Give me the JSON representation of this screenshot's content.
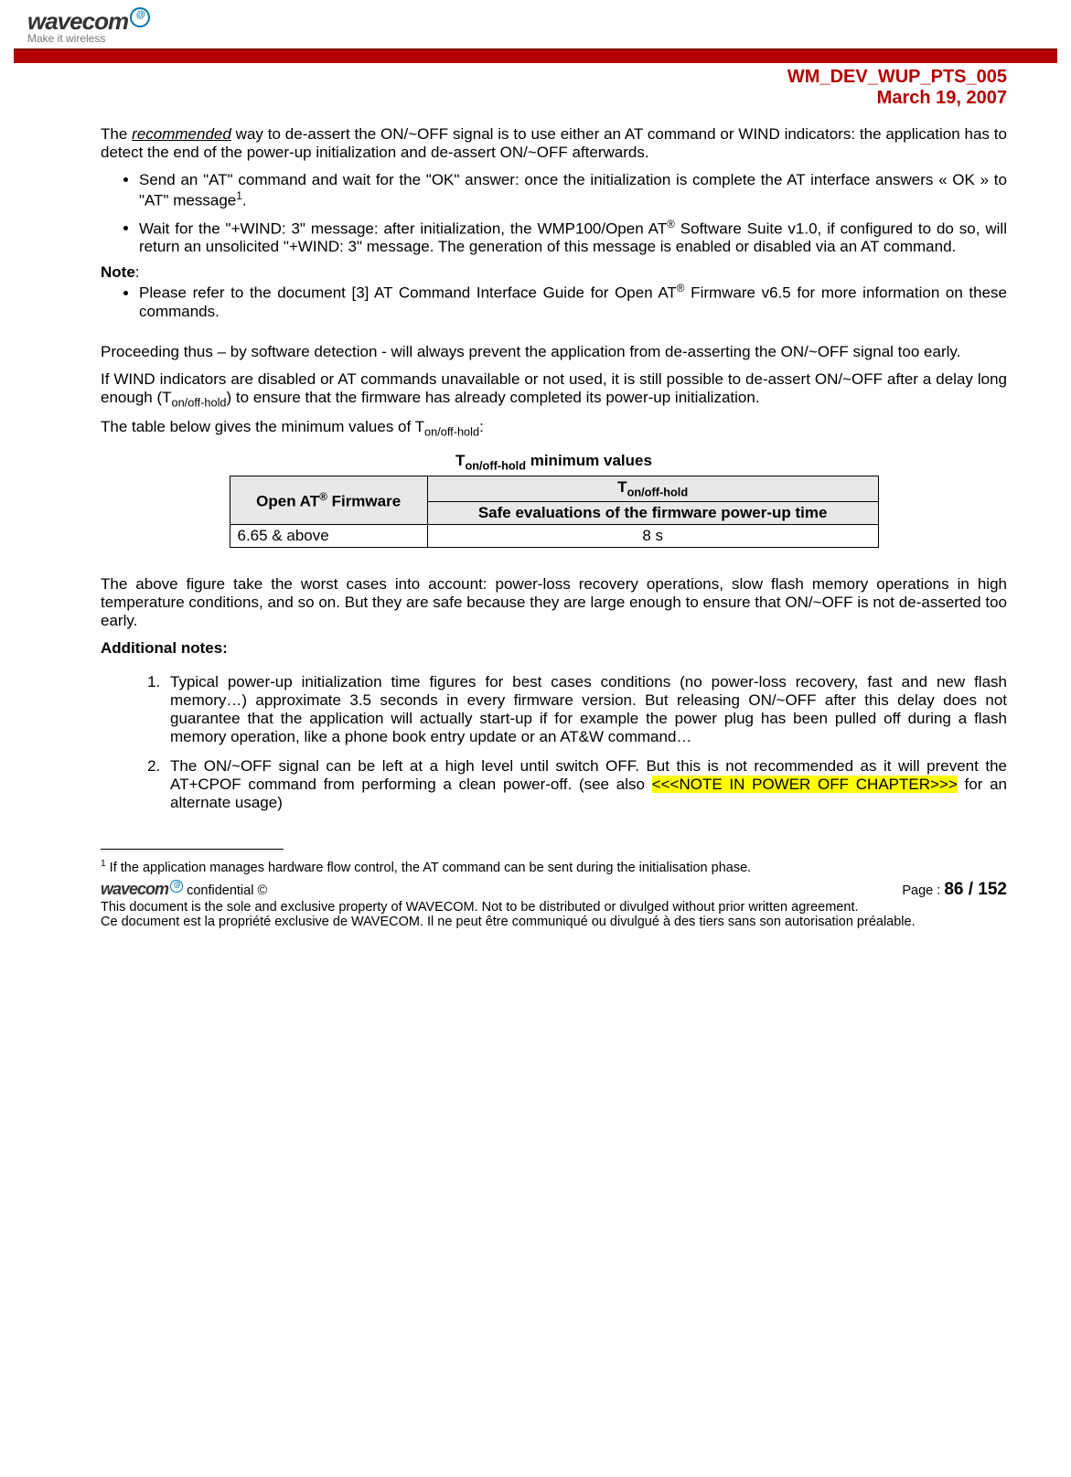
{
  "brand": {
    "name": "wavecom",
    "tagline": "Make it wireless"
  },
  "doc_id_line1": "WM_DEV_WUP_PTS_005",
  "doc_id_line2": "March 19, 2007",
  "intro_p1_a": "The ",
  "intro_p1_rec": "recommended",
  "intro_p1_b": " way to de-assert the ON/~OFF signal is to use either an AT command or WIND indicators: the application has to detect the end of the power-up initialization and de-assert ON/~OFF afterwards.",
  "bullet1_a": "Send an \"AT\" command and wait for the \"OK\" answer: once the initialization is complete the AT interface answers « OK » to \"AT\" message",
  "bullet1_fn": "1",
  "bullet1_b": ".",
  "bullet2_a": "Wait for the \"+WIND: 3\" message: after initialization, the WMP100/Open AT",
  "bullet2_b": " Software Suite v1.0, if configured to do so, will return an unsolicited \"+WIND: 3\" message. The generation of this message is enabled or disabled via an AT command.",
  "reg": "®",
  "note_label": "Note",
  "note_colon": ":",
  "note_item_a": "Please refer to the document [3] AT Command Interface Guide for Open AT",
  "note_item_b": " Firmware v6.5 for more information on these commands.",
  "p2": "Proceeding thus – by software detection - will always prevent the application from de-asserting the ON/~OFF signal too early.",
  "p3_a": "If WIND indicators are disabled or AT commands unavailable or not used, it is still possible to de-assert ON/~OFF after a delay long enough (T",
  "sub_onoff": "on/off-hold",
  "p3_b": ") to ensure that the firmware has already completed its power-up initialization.",
  "p4_a": "The table below gives the minimum values of T",
  "p4_b": ":",
  "table_title_a": "T",
  "table_title_b": " minimum values",
  "th_left": "Open AT",
  "th_left2": " Firmware",
  "th_right_top_a": "T",
  "th_right_bottom": "Safe evaluations of the firmware power-up time",
  "td_left": "6.65 & above",
  "td_right": "8 s",
  "p5": "The above figure take the worst cases into account: power-loss recovery operations, slow flash memory operations in high temperature conditions, and so on. But they are safe because they are large enough to ensure that ON/~OFF is not de-asserted too early.",
  "add_notes_label": "Additional notes:",
  "oln1": "Typical power-up initialization time figures for best cases conditions (no power-loss recovery, fast and new flash memory…) approximate 3.5 seconds in every firmware version. But releasing ON/~OFF after this delay does not guarantee that the application will actually start-up if for example the power plug has been pulled off during a flash memory operation, like a phone book entry update or an AT&W command…",
  "oln2_a": "The ON/~OFF signal can be left at a high level until switch OFF. But this is not recommended as it will prevent the AT+CPOF command from performing a clean power-off. (see also ",
  "oln2_hl": "<<<NOTE IN POWER OFF CHAPTER>>>",
  "oln2_b": " for an alternate usage)",
  "footnote_num": "1",
  "footnote_txt": " If the application manages hardware flow control, the AT command can be sent during the initialisation phase.",
  "footer_conf": "confidential ©",
  "footer_page_label": "Page : ",
  "footer_page_now": "86",
  "footer_page_sep": " / ",
  "footer_page_total": "152",
  "footer_line2": "This document is the sole and exclusive property of WAVECOM. Not to be distributed or divulged without prior written agreement.",
  "footer_line3": "Ce document est la propriété exclusive de WAVECOM. Il ne peut être communiqué ou divulgué à des tiers sans son autorisation préalable."
}
